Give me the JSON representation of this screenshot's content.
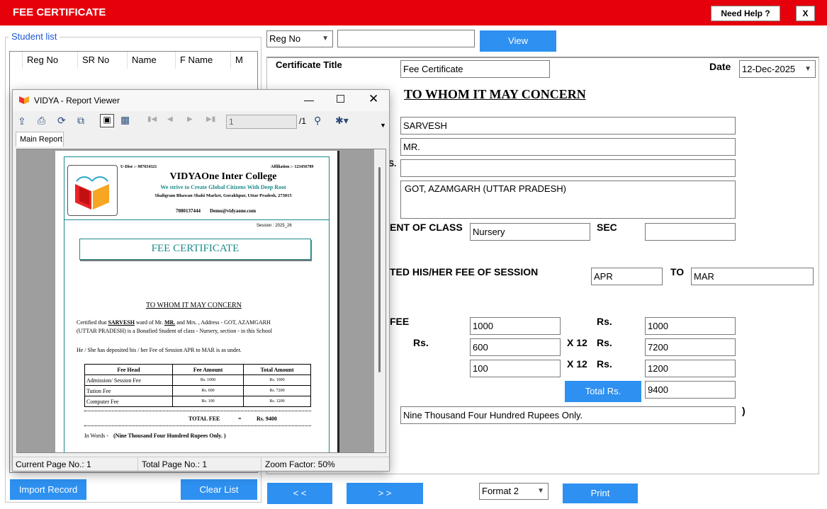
{
  "app": {
    "title": "FEE CERTIFICATE",
    "help_label": "Need Help ?",
    "close_label": "X"
  },
  "student_list": {
    "title": "Student list",
    "columns": [
      "Reg No",
      "SR No",
      "Name",
      "F Name",
      "M Nar"
    ],
    "import_label": "Import Record",
    "clear_label": "Clear List"
  },
  "search": {
    "filter_value": "Reg No",
    "input_value": "",
    "view_label": "View"
  },
  "form": {
    "certificate_title_label": "Certificate Title",
    "certificate_title_value": "Fee Certificate",
    "date_label": "Date",
    "date_value": "12-Dec-2025",
    "heading": "TO WHOM IT MAY CONCERN",
    "name_value": "SARVESH",
    "father_prefix": "MR.",
    "mother_label_fragment": "S.",
    "mother_value": "",
    "address_value": "GOT, AZAMGARH (UTTAR PRADESH)",
    "class_label": "ENT OF CLASS",
    "class_value": "Nursery",
    "sec_label": "SEC",
    "sec_value": "",
    "session_label": "TED HIS/HER FEE OF SESSION",
    "session_from": "APR",
    "to_label": "TO",
    "session_to": "MAR",
    "fee_label": "FEE",
    "rs_left_label": "Rs.",
    "fee_rows": [
      {
        "amount": "1000",
        "multiplier": "",
        "rs": "Rs.",
        "total": "1000"
      },
      {
        "amount": "600",
        "multiplier": "X 12",
        "rs": "Rs.",
        "total": "7200"
      },
      {
        "amount": "100",
        "multiplier": "X 12",
        "rs": "Rs.",
        "total": "1200"
      }
    ],
    "total_button": "Total Rs.",
    "total_value": "9400",
    "words_value": "Nine Thousand Four Hundred Rupees Only.",
    "close_paren": ")"
  },
  "bottom": {
    "prev_label": "< <",
    "next_label": "> >",
    "format_value": "Format 2",
    "print_label": "Print"
  },
  "viewer": {
    "window_title": "VIDYA - Report Viewer",
    "page_input": "1",
    "page_total": "/1",
    "tab_label": "Main Report",
    "status_current": "Current Page No.: 1",
    "status_total": "Total Page No.: 1",
    "status_zoom": "Zoom Factor: 50%"
  },
  "report": {
    "udise": "U-Dise :- 987654321",
    "affiliation": "Affiliation :- 123456789",
    "school_name": "VIDYAOne Inter College",
    "motto": "We strive to Create Global Citizens With Deep Root",
    "address": "Shaligram Bhawan Shahi Market, Gorakhpur, Uttar Pradesh, 273015",
    "phone": "7080137444",
    "email": "Demo@vidyaone.com",
    "session": "Session : 2025_26",
    "title": "FEE CERTIFICATE",
    "concern": "TO WHOM IT MAY CONCERN",
    "para1_a": "Certified that",
    "para1_name": "SARVESH",
    "para1_b": "ward of Mr.",
    "para1_mr": "MR.",
    "para1_c": "and Mrs. , Address - GOT, AZAMGARH",
    "para1_d": "(UTTAR PRADESH) is a Bonafied Student of class - Nursery, section -  in this School",
    "para2": "He / She has deposited his / her Fee of Session APR to MAR is as under.",
    "table_headers": [
      "Fee Head",
      "Fee Amount",
      "Total Amount"
    ],
    "table_rows": [
      [
        "Admission/ Session Fee",
        "Rs. 1000",
        "Rs. 1000"
      ],
      [
        "Tution Fee",
        "Rs. 600",
        "Rs. 7200"
      ],
      [
        "Computer Fee",
        "Rs. 100",
        "Rs. 1200"
      ]
    ],
    "total_label": "TOTAL FEE",
    "total_eq": "=",
    "total_value": "Rs. 9400",
    "in_words_label": "In Words -",
    "in_words_value": "(Nine Thousand Four Hundred Rupees Only.  )"
  },
  "colors": {
    "header_red": "#e5000b",
    "button_blue": "#2e90f0",
    "teal": "#1a8a8a"
  }
}
